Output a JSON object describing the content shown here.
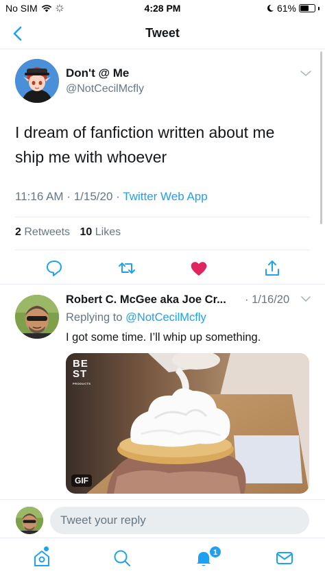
{
  "status_bar": {
    "carrier": "No SIM",
    "time": "4:28 PM",
    "battery": "61%",
    "battery_level": 0.61
  },
  "header": {
    "title": "Tweet"
  },
  "tweet": {
    "display_name": "Don't @ Me",
    "handle": "@NotCecilMcfly",
    "text_line1": "I dream of fanfiction written about me",
    "text_line2": "ship me with whoever",
    "time": "11:16 AM",
    "date": "1/15/20",
    "source": "Twitter Web App",
    "retweets_count": "2",
    "retweets_label": "Retweets",
    "likes_count": "10",
    "likes_label": "Likes",
    "liked": true
  },
  "reply": {
    "display_name": "Robert C. McGee aka Joe Cr...",
    "date": "1/16/20",
    "replying_to_label": "Replying to",
    "replying_to_handle": "@NotCecilMcfly",
    "text": "I got some time. I’ll whip up something.",
    "gif_badge": "GIF",
    "gif_brand_line1": "BE",
    "gif_brand_line2": "ST",
    "gif_brand_sub": "PRODUCTS"
  },
  "composer": {
    "placeholder": "Tweet your reply"
  },
  "tab_bar": {
    "notifications_count": "1"
  },
  "colors": {
    "accent": "#1da1f2",
    "like": "#e0245e",
    "secondary_text": "#657786"
  }
}
